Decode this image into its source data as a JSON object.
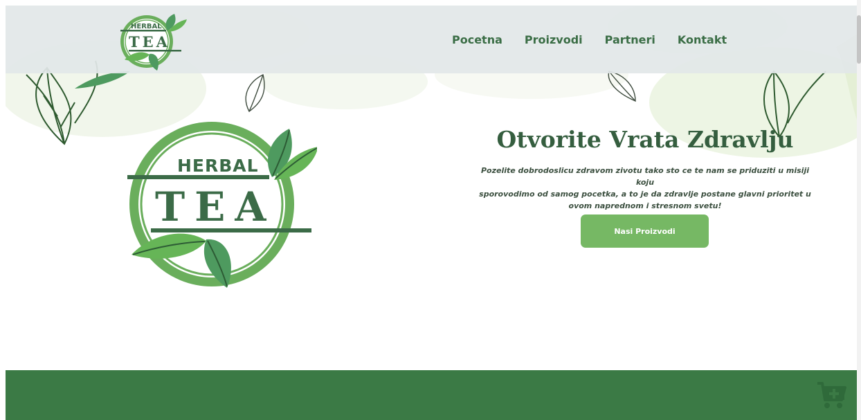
{
  "brand": {
    "logo_word_top": "HERBAL",
    "logo_word_bottom": "TEA"
  },
  "nav": {
    "links": [
      {
        "label": "Pocetna"
      },
      {
        "label": "Proizvodi"
      },
      {
        "label": "Partneri"
      },
      {
        "label": "Kontakt"
      }
    ]
  },
  "hero": {
    "title": "Otvorite Vrata Zdravlju",
    "lines": [
      "Pozelite dobrodoslicu zdravom zivotu tako sto ce te nam se priduziti u misiji koju",
      "sporovodimo od samog pocetka, a to je da zdravlje postane glavni prioritet u",
      "ovom naprednom i stresnom svetu!"
    ],
    "cta_label": "Nasi Proizvodi"
  },
  "icons": {
    "cart": "cart-plus-icon"
  },
  "colors": {
    "brand_dark": "#355e3f",
    "brand_green": "#6aae5c",
    "button": "#76b864",
    "footer_band": "#3b7a45",
    "navbar": "#e2e7e8"
  }
}
